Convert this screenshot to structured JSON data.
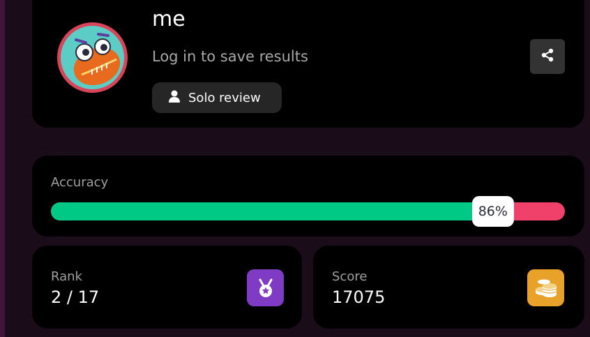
{
  "profile": {
    "username": "me",
    "login_prompt": "Log in to save results",
    "solo_review_label": "Solo review",
    "avatar_icon": "monster-avatar",
    "share_icon": "share-icon"
  },
  "accuracy": {
    "label": "Accuracy",
    "percent_text": "86%",
    "correct_fraction": 0.86,
    "correct_color": "#00c985",
    "incorrect_color": "#f0416b"
  },
  "rank": {
    "label": "Rank",
    "value": "2 / 17",
    "icon": "medal-icon",
    "icon_color": "#7f3bc4"
  },
  "score": {
    "label": "Score",
    "value": "17075",
    "icon": "coins-icon",
    "icon_color": "#e8a22a"
  }
}
